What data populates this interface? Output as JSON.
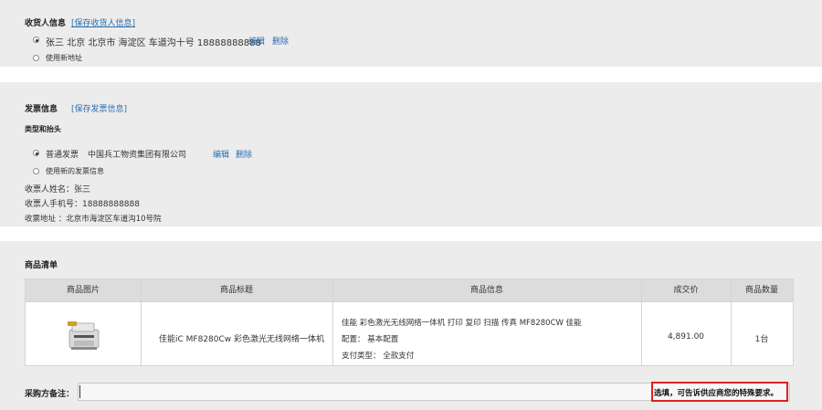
{
  "receiver": {
    "title": "收货人信息",
    "save_link": "[保存收货人信息]",
    "address": "张三 北京 北京市 海淀区 车道沟十号 18888888888",
    "edit": "编辑",
    "delete": "删除",
    "new_address": "使用新地址"
  },
  "invoice": {
    "title": "发票信息",
    "save_link": "[保存发票信息]",
    "type_header": "类型和抬头",
    "option_type": "普通发票",
    "option_company": "中国兵工物资集团有限公司",
    "edit": "编辑",
    "delete": "删除",
    "new_invoice": "使用新的发票信息",
    "name_line": "收票人姓名：张三",
    "phone_line": "收票人手机号：18888888888",
    "address_line": "收票地址 ：北京市海淀区车道沟10号院"
  },
  "goods": {
    "title": "商品清单",
    "columns": [
      "商品图片",
      "商品标题",
      "商品信息",
      "成交价",
      "商品数量"
    ],
    "rows": [
      {
        "title": "佳能iC MF8280Cw 彩色激光无线网络一体机",
        "info_line1": "佳能 彩色激光无线网络一体机 打印 复印 扫描 传真 MF8280CW 佳能",
        "info_line2": "配置： 基本配置",
        "info_line3": "支付类型： 全款支付",
        "price": "4,891.00",
        "quantity": "1台"
      }
    ]
  },
  "remark": {
    "label": "采购方备注：",
    "hint": "选填，可告诉供应商您的特殊要求。"
  }
}
